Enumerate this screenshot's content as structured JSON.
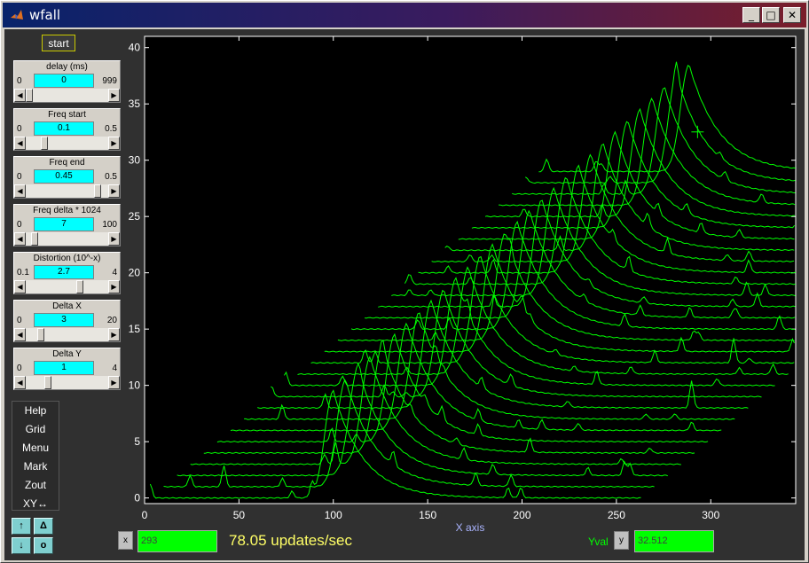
{
  "window": {
    "title": "wfall"
  },
  "titlebar_buttons": {
    "minimize": "_",
    "maximize": "□",
    "close": "✕"
  },
  "start_label": "start",
  "controls": [
    {
      "label": "delay (ms)",
      "min": "0",
      "max": "999",
      "value": "0",
      "fraction": 0.0
    },
    {
      "label": "Freq start",
      "min": "0",
      "max": "0.5",
      "value": "0.1",
      "fraction": 0.2
    },
    {
      "label": "Freq end",
      "min": "0",
      "max": "0.5",
      "value": "0.45",
      "fraction": 0.9
    },
    {
      "label": "Freq delta * 1024",
      "min": "0",
      "max": "100",
      "value": "7",
      "fraction": 0.07
    },
    {
      "label": "Distortion (10^-x)",
      "min": "0.1",
      "max": "4",
      "value": "2.7",
      "fraction": 0.67
    },
    {
      "label": "Delta X",
      "min": "0",
      "max": "20",
      "value": "3",
      "fraction": 0.15
    },
    {
      "label": "Delta Y",
      "min": "0",
      "max": "4",
      "value": "1",
      "fraction": 0.25
    }
  ],
  "menu": [
    "Help",
    "Grid",
    "Menu",
    "Mark",
    "Zout",
    "XY↔"
  ],
  "arrow_buttons": {
    "up": "↑",
    "delta": "Δ",
    "down": "↓",
    "o": "o"
  },
  "bottom": {
    "x_label": "x",
    "x_value": "293",
    "rate": "78.05 updates/sec",
    "yval_label": "Yval",
    "y_label": "y",
    "y_value": "32.512"
  },
  "chart_data": {
    "type": "line",
    "xlabel": "X axis",
    "ylabel": "",
    "xlim": [
      0,
      345
    ],
    "ylim": [
      -0.5,
      41
    ],
    "xticks": [
      0,
      50,
      100,
      150,
      200,
      250,
      300
    ],
    "yticks": [
      0,
      5,
      10,
      15,
      20,
      25,
      30,
      35,
      40
    ],
    "trace_count": 30,
    "trace_spacing_x": 7.1,
    "trace_spacing_y": 1.0,
    "trace_width": 260,
    "main_peak_start_x": 100,
    "main_peak_shift_per_trace": 6.5,
    "main_peak_height": 9.5,
    "marker": {
      "x": 293,
      "y": 32.512
    },
    "line_color": "#00ff00",
    "background": "#000000",
    "axis_color": "#ffffff"
  },
  "colors": {
    "accent_cyan": "#00ffff",
    "field_green": "#00ff00",
    "rate_yellow": "#ffff66"
  }
}
